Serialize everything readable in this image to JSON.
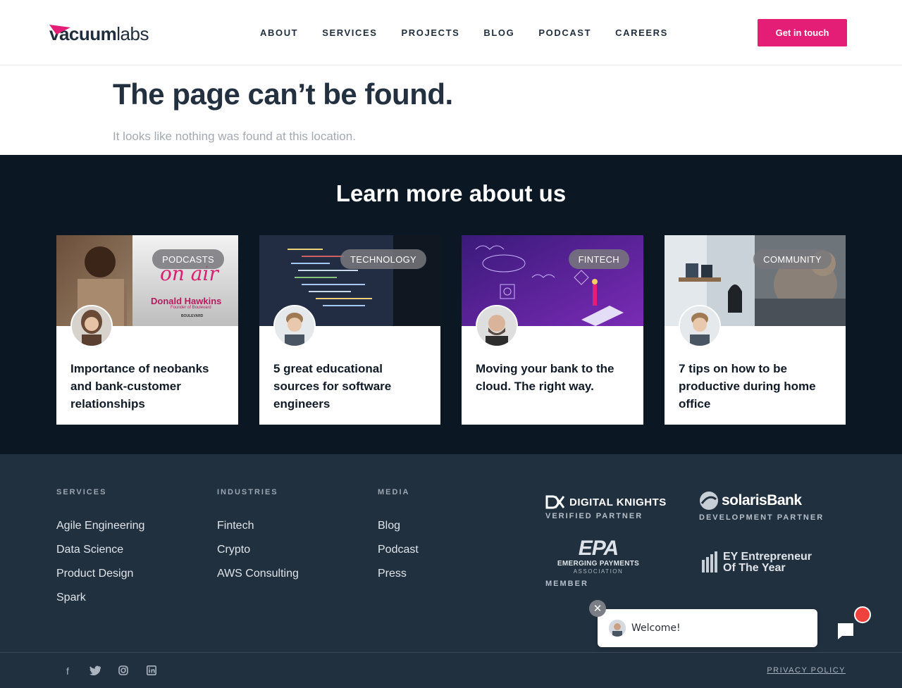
{
  "header": {
    "logo_text_bold": "vacuum",
    "logo_text_light": "labs",
    "nav": [
      "ABOUT",
      "SERVICES",
      "PROJECTS",
      "BLOG",
      "PODCAST",
      "CAREERS"
    ],
    "cta_label": "Get in touch",
    "accent": "#e41e77"
  },
  "notfound": {
    "title": "The page can’t be found.",
    "subtitle": "It looks like nothing was found at this location."
  },
  "learn": {
    "title": "Learn more about us",
    "cards": [
      {
        "badge": "PODCASTS",
        "title": "Importance of neobanks and bank-customer relationships",
        "img_text_1": "on air",
        "img_text_2": "Donald Hawkins",
        "img_text_3": "Founder of Boulevard",
        "img_text_4": "BOULEVARD"
      },
      {
        "badge": "TECHNOLOGY",
        "title": "5 great educational sources for software engineers"
      },
      {
        "badge": "FINTECH",
        "title": "Moving your bank to the cloud. The right way."
      },
      {
        "badge": "COMMUNITY",
        "title": "7 tips on how to be productive during home office"
      }
    ]
  },
  "footer": {
    "columns": [
      {
        "head": "SERVICES",
        "links": [
          "Agile Engineering",
          "Data Science",
          "Product Design",
          "Spark"
        ]
      },
      {
        "head": "INDUSTRIES",
        "links": [
          "Fintech",
          "Crypto",
          "AWS Consulting"
        ]
      },
      {
        "head": "MEDIA",
        "links": [
          "Blog",
          "Podcast",
          "Press"
        ]
      }
    ],
    "partners": {
      "dk_name": "DIGITAL KNIGHTS",
      "dk_caption": "VERIFIED PARTNER",
      "solaris_name": "solarisBank",
      "solaris_caption": "DEVELOPMENT PARTNER",
      "epa_mark": "EPA",
      "epa_name": "EMERGING PAYMENTS",
      "epa_sub": "ASSOCIATION",
      "epa_caption": "MEMBER",
      "ey_line1": "EY Entrepreneur",
      "ey_line2": "Of The Year"
    },
    "social_icons": [
      "facebook-icon",
      "twitter-icon",
      "instagram-icon",
      "linkedin-icon"
    ],
    "privacy": "PRIVACY POLICY"
  },
  "chat": {
    "message": "Welcome!",
    "close_glyph": "✕"
  }
}
